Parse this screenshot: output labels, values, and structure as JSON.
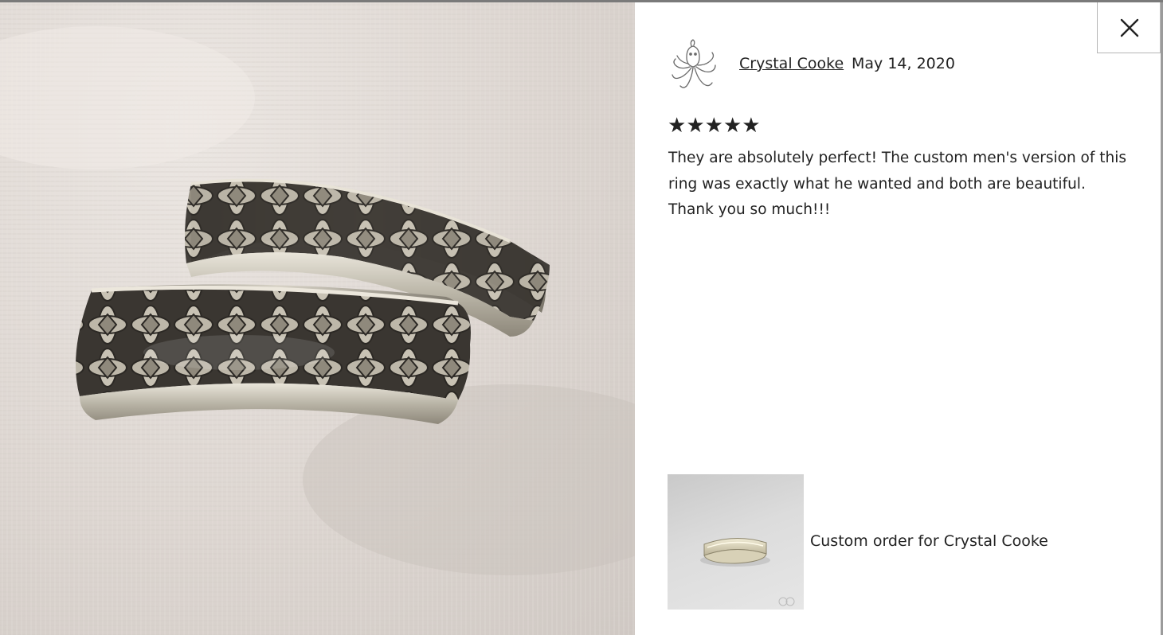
{
  "review": {
    "reviewer_name": "Crystal Cooke",
    "date": "May 14, 2020",
    "rating": 5,
    "stars": [
      "★",
      "★",
      "★",
      "★",
      "★"
    ],
    "text": "They are absolutely perfect! The custom men's version of this ring was exactly what he wanted and both are beautiful. Thank you so much!!!"
  },
  "listing": {
    "caption": "Custom order for Crystal Cooke"
  },
  "icons": {
    "close": "close-icon",
    "avatar": "octopus-avatar-icon"
  },
  "colors": {
    "text": "#222222",
    "star": "#222222",
    "border": "#b5b5b5"
  }
}
